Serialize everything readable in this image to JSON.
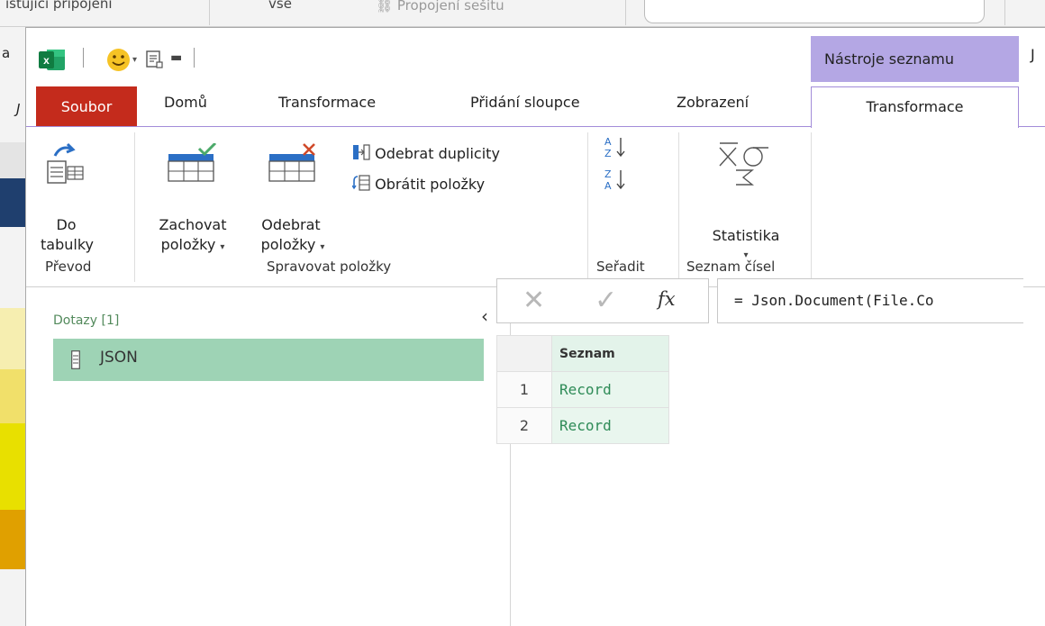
{
  "background": {
    "top_fragments": [
      "istující připojení",
      "vše",
      "Propojení sešitu"
    ],
    "left_fragments": [
      "a",
      "J"
    ],
    "stripe_colors": [
      "#1f3f6e",
      "#f6eeb0",
      "#f1e06a",
      "#e8e000",
      "#e0a000"
    ]
  },
  "window": {
    "title_fragment": "J",
    "context_tab_header": "Nástroje seznamu",
    "accent_color": "#b4a7e4",
    "file_tab_color": "#c42b1c"
  },
  "tabs": {
    "file": "Soubor",
    "home": "Domů",
    "transform": "Transformace",
    "add_column": "Přidání sloupce",
    "view": "Zobrazení",
    "list_transform": "Transformace"
  },
  "ribbon": {
    "convert": {
      "to_table_line1": "Do",
      "to_table_line2": "tabulky",
      "group_label": "Převod"
    },
    "manage_items": {
      "keep_line1": "Zachovat",
      "keep_line2": "položky",
      "remove_line1": "Odebrat",
      "remove_line2": "položky",
      "remove_duplicates": "Odebrat duplicity",
      "reverse_items": "Obrátit položky",
      "group_label": "Spravovat položky"
    },
    "sort": {
      "group_label": "Seřadit"
    },
    "number_list": {
      "statistics": "Statistika",
      "group_label": "Seznam čísel"
    },
    "dropdown_glyph": "▾"
  },
  "queries": {
    "title": "Dotazy [1]",
    "collapse_glyph": "‹",
    "items": [
      {
        "label": "JSON"
      }
    ]
  },
  "formula_bar": {
    "cancel_glyph": "✕",
    "confirm_glyph": "✓",
    "fx": "fx",
    "formula": "= Json.Document(File.Co"
  },
  "grid": {
    "header": "Seznam",
    "rows": [
      {
        "num": "1",
        "value": "Record"
      },
      {
        "num": "2",
        "value": "Record"
      }
    ]
  }
}
